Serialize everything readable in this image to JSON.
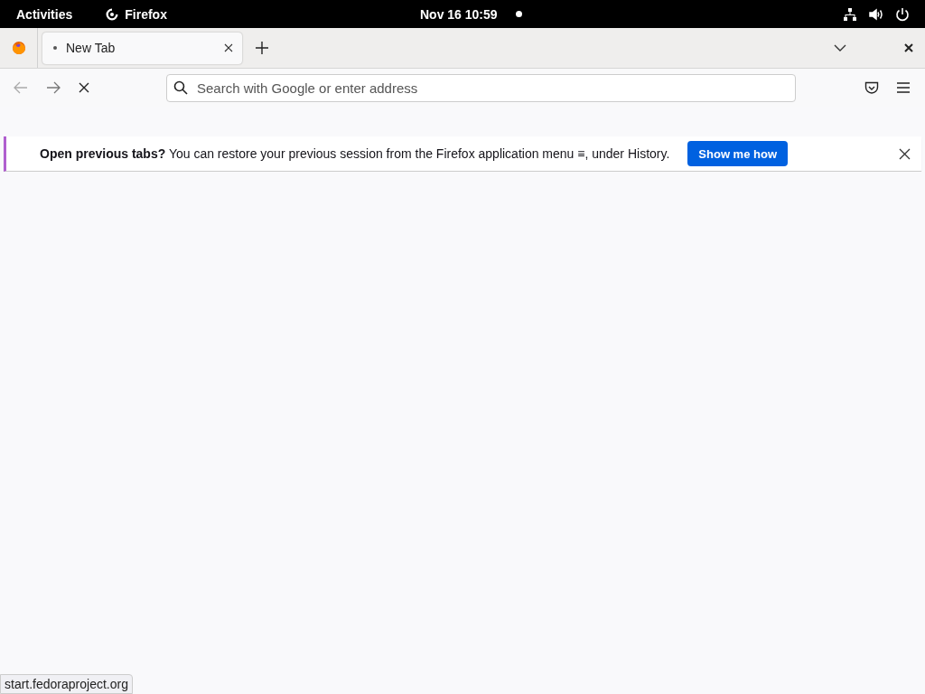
{
  "top_bar": {
    "activities": "Activities",
    "app_name": "Firefox",
    "clock": "Nov 16  10:59"
  },
  "tabs": [
    {
      "label": "New Tab",
      "selected": true
    }
  ],
  "address_bar": {
    "placeholder": "Search with Google or enter address"
  },
  "notification": {
    "message": "**Open previous tabs?** You can restore your previous session from the Firefox application menu ≡, under History.",
    "button": "Show me how"
  },
  "status_bar": {
    "url": "start.fedoraproject.org"
  }
}
